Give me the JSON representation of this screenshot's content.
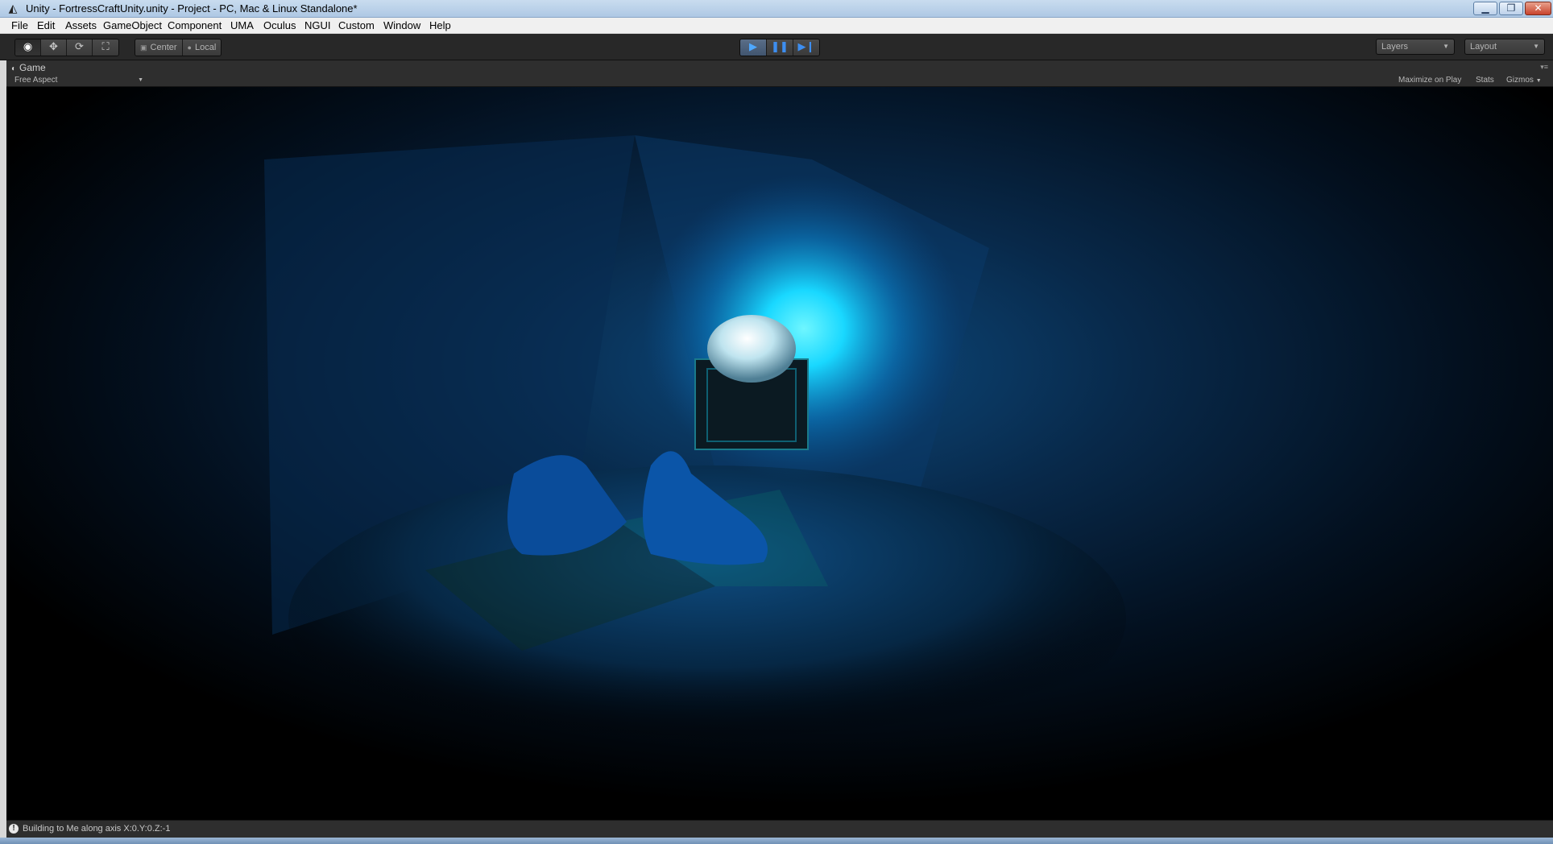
{
  "window": {
    "title": "Unity - FortressCraftUnity.unity - Project - PC, Mac & Linux Standalone*",
    "app_icon": "unity-logo-icon"
  },
  "menu": {
    "items": [
      "File",
      "Edit",
      "Assets",
      "GameObject",
      "Component",
      "UMA",
      "Oculus",
      "NGUI",
      "Custom",
      "Window",
      "Help"
    ]
  },
  "toolbar": {
    "transform_tools": [
      "eye-icon",
      "move-icon",
      "rotate-icon",
      "scale-icon"
    ],
    "pivot_center": "Center",
    "pivot_local": "Local",
    "play_controls": [
      "play-icon",
      "pause-icon",
      "step-icon"
    ],
    "layers_label": "Layers",
    "layout_label": "Layout"
  },
  "game_panel": {
    "tab_label": "Game",
    "aspect": "Free Aspect",
    "maximize_on_play": "Maximize on Play",
    "stats": "Stats",
    "gizmos": "Gizmos"
  },
  "status": {
    "message": "Building to Me along axis X:0.Y:0.Z:-1"
  },
  "colors": {
    "light_glow": "#19d8ff",
    "scene_blue": "#0a3a6a",
    "toolbar_bg": "#282828",
    "play_blue": "#3d8ef0"
  }
}
